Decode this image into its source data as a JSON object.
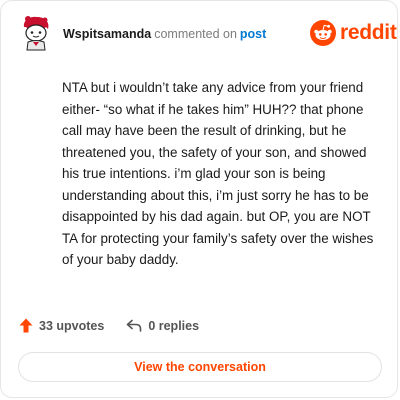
{
  "header": {
    "username": "Wspitsamanda",
    "action": "commented on",
    "post_link": "post"
  },
  "brand": {
    "wordmark": "reddit",
    "color": "#ff4500",
    "icon": "reddit-alien-icon"
  },
  "comment": {
    "text": "NTA but i wouldn’t take any advice from your friend either- “so what if he takes him” HUH?? that phone call may have been the result of drinking, but he threatened you, the safety of your son, and showed his true intentions. i’m glad your son is being understanding about this, i’m just sorry he has to be disappointed by his dad again. but OP, you are NOT TA for protecting your family’s safety over the wishes of your baby daddy."
  },
  "footer": {
    "upvotes_label": "33 upvotes",
    "upvote_icon": "upvote-arrow-icon",
    "upvote_color": "#ff4500",
    "replies_label": "0 replies",
    "reply_icon": "reply-arrow-icon"
  },
  "cta": {
    "label": "View the conversation"
  }
}
